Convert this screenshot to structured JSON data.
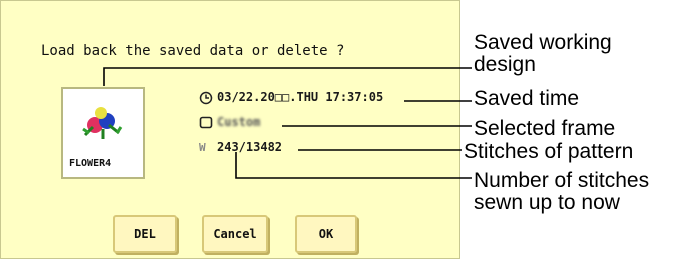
{
  "dialog": {
    "prompt": "Load back the saved data or delete ?",
    "design_name": "FLOWER4",
    "saved_time": "03/22.20□□.THU 17:37:05",
    "frame_name": "Custom",
    "stitches": "243/13482",
    "stitch_prefix": "W",
    "buttons": {
      "del": "DEL",
      "cancel": "Cancel",
      "ok": "OK"
    },
    "colors": {
      "panel": "#ffffc4",
      "button": "#fff7c0"
    }
  },
  "callouts": {
    "saved_design_line1": "Saved working",
    "saved_design_line2": "design",
    "saved_time": "Saved time",
    "selected_frame": "Selected frame",
    "stitches_of_pattern": "Stitches of pattern",
    "sewn_line1": "Number of stitches",
    "sewn_line2": "sewn up to now"
  },
  "icons": {
    "time": "clock-icon",
    "frame": "frame-icon"
  }
}
